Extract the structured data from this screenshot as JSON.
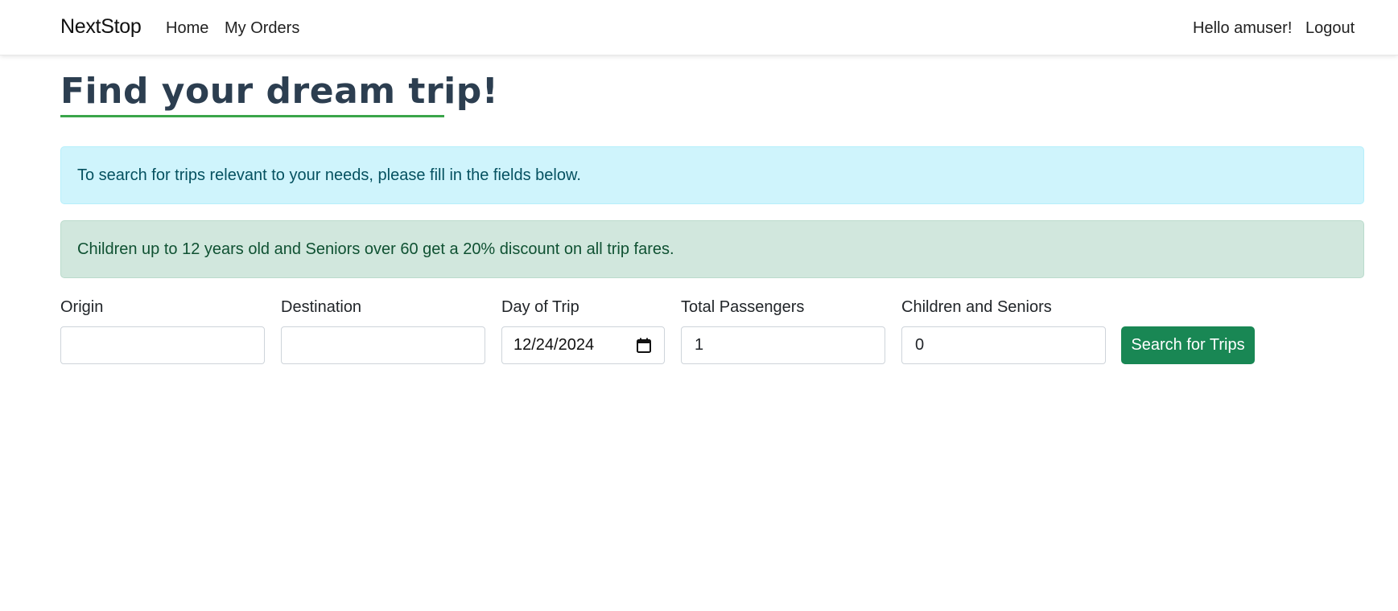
{
  "navbar": {
    "brand": "NextStop",
    "links": [
      {
        "label": "Home"
      },
      {
        "label": "My Orders"
      }
    ],
    "greeting": "Hello amuser!",
    "logout_label": "Logout"
  },
  "page": {
    "title": "Find your dream trip!",
    "title_underline_color": "#3aa54a"
  },
  "alerts": {
    "info": "To search for trips relevant to your needs, please fill in the fields below.",
    "success": "Children up to 12 years old and Seniors over 60 get a 20% discount on all trip fares."
  },
  "form": {
    "origin": {
      "label": "Origin",
      "value": ""
    },
    "destination": {
      "label": "Destination",
      "value": ""
    },
    "day_of_trip": {
      "label": "Day of Trip",
      "value": "12/24/2024",
      "icon": "calendar-icon"
    },
    "total_passengers": {
      "label": "Total Passengers",
      "value": "1"
    },
    "children_seniors": {
      "label": "Children and Seniors",
      "value": "0"
    },
    "submit_label": "Search for Trips",
    "submit_color": "#198754"
  }
}
